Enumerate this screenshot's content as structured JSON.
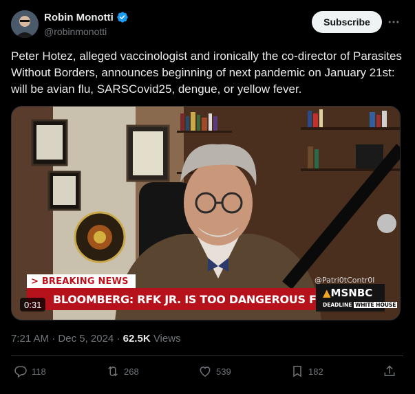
{
  "author": {
    "name": "Robin Monotti",
    "handle": "@robinmonotti",
    "verified": true
  },
  "subscribe_label": "Subscribe",
  "tweet_text": "Peter Hotez, alleged vaccinologist and ironically the co-director of Parasites Without Borders, announces beginning of next pandemic on January 21st: will be avian flu, SARSCovid25, dengue, or yellow fever.",
  "video": {
    "breaking_tag": "BREAKING NEWS",
    "chyron": "BLOOMBERG: RFK JR. IS TOO DANGEROUS FOR GOVERNMENT",
    "network": "MSNBC",
    "show_left": "DEADLINE",
    "show_right": "WHITE HOUSE",
    "watermark": "@Patri0tContr0l",
    "duration": "0:31"
  },
  "meta": {
    "time": "7:21 AM",
    "separator": "·",
    "date": "Dec 5, 2024",
    "views_count": "62.5K",
    "views_label": "Views"
  },
  "actions": {
    "replies": "118",
    "reposts": "268",
    "likes": "539",
    "bookmarks": "182"
  },
  "colors": {
    "background": "#000000",
    "text": "#e7e9ea",
    "muted": "#71767b",
    "verified": "#1d9bf0",
    "chyron_red": "#b5121b"
  }
}
